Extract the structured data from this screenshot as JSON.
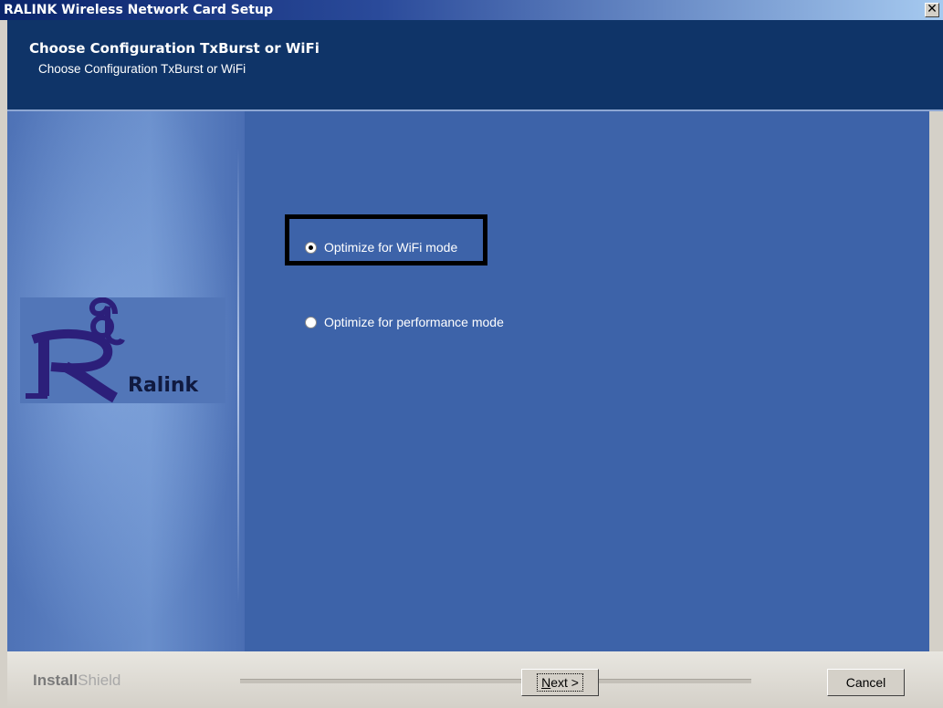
{
  "window": {
    "title": "RALINK Wireless Network Card Setup",
    "close_label": "✕"
  },
  "header": {
    "title": "Choose Configuration TxBurst or WiFi",
    "subtitle": "Choose Configuration TxBurst or WiFi"
  },
  "logo": {
    "brand": "Ralink"
  },
  "options": [
    {
      "label": "Optimize for WiFi mode",
      "selected": true
    },
    {
      "label": "Optimize for performance mode",
      "selected": false
    }
  ],
  "footer": {
    "installshield_bold": "Install",
    "installshield_light": "Shield",
    "next_label_prefix": "N",
    "next_label_rest": "ext >",
    "cancel_label": "Cancel"
  },
  "colors": {
    "header_bg": "#0f3468",
    "panel_bg": "#3d63a9",
    "highlight_border": "#000000"
  }
}
